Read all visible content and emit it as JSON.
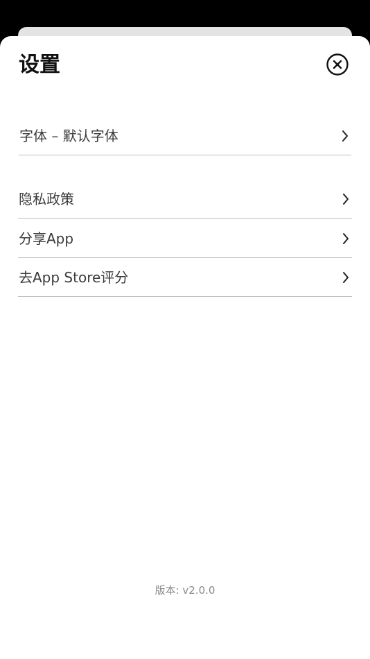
{
  "header": {
    "title": "设置"
  },
  "rows": [
    {
      "label": "字体 – 默认字体"
    },
    {
      "label": "隐私政策"
    },
    {
      "label": "分享App"
    },
    {
      "label": "去App Store评分"
    }
  ],
  "footer": {
    "version": "版本: v2.0.0"
  },
  "icons": {
    "close": "close-circle-icon",
    "chevron": "chevron-right-icon"
  },
  "colors": {
    "background": "#000000",
    "sheet": "#ffffff",
    "backdrop_sheet": "#e4e4e4",
    "title": "#111111",
    "row_text": "#3b3b3b",
    "divider": "#bdbdbd",
    "version_text": "#8a8a8a"
  }
}
